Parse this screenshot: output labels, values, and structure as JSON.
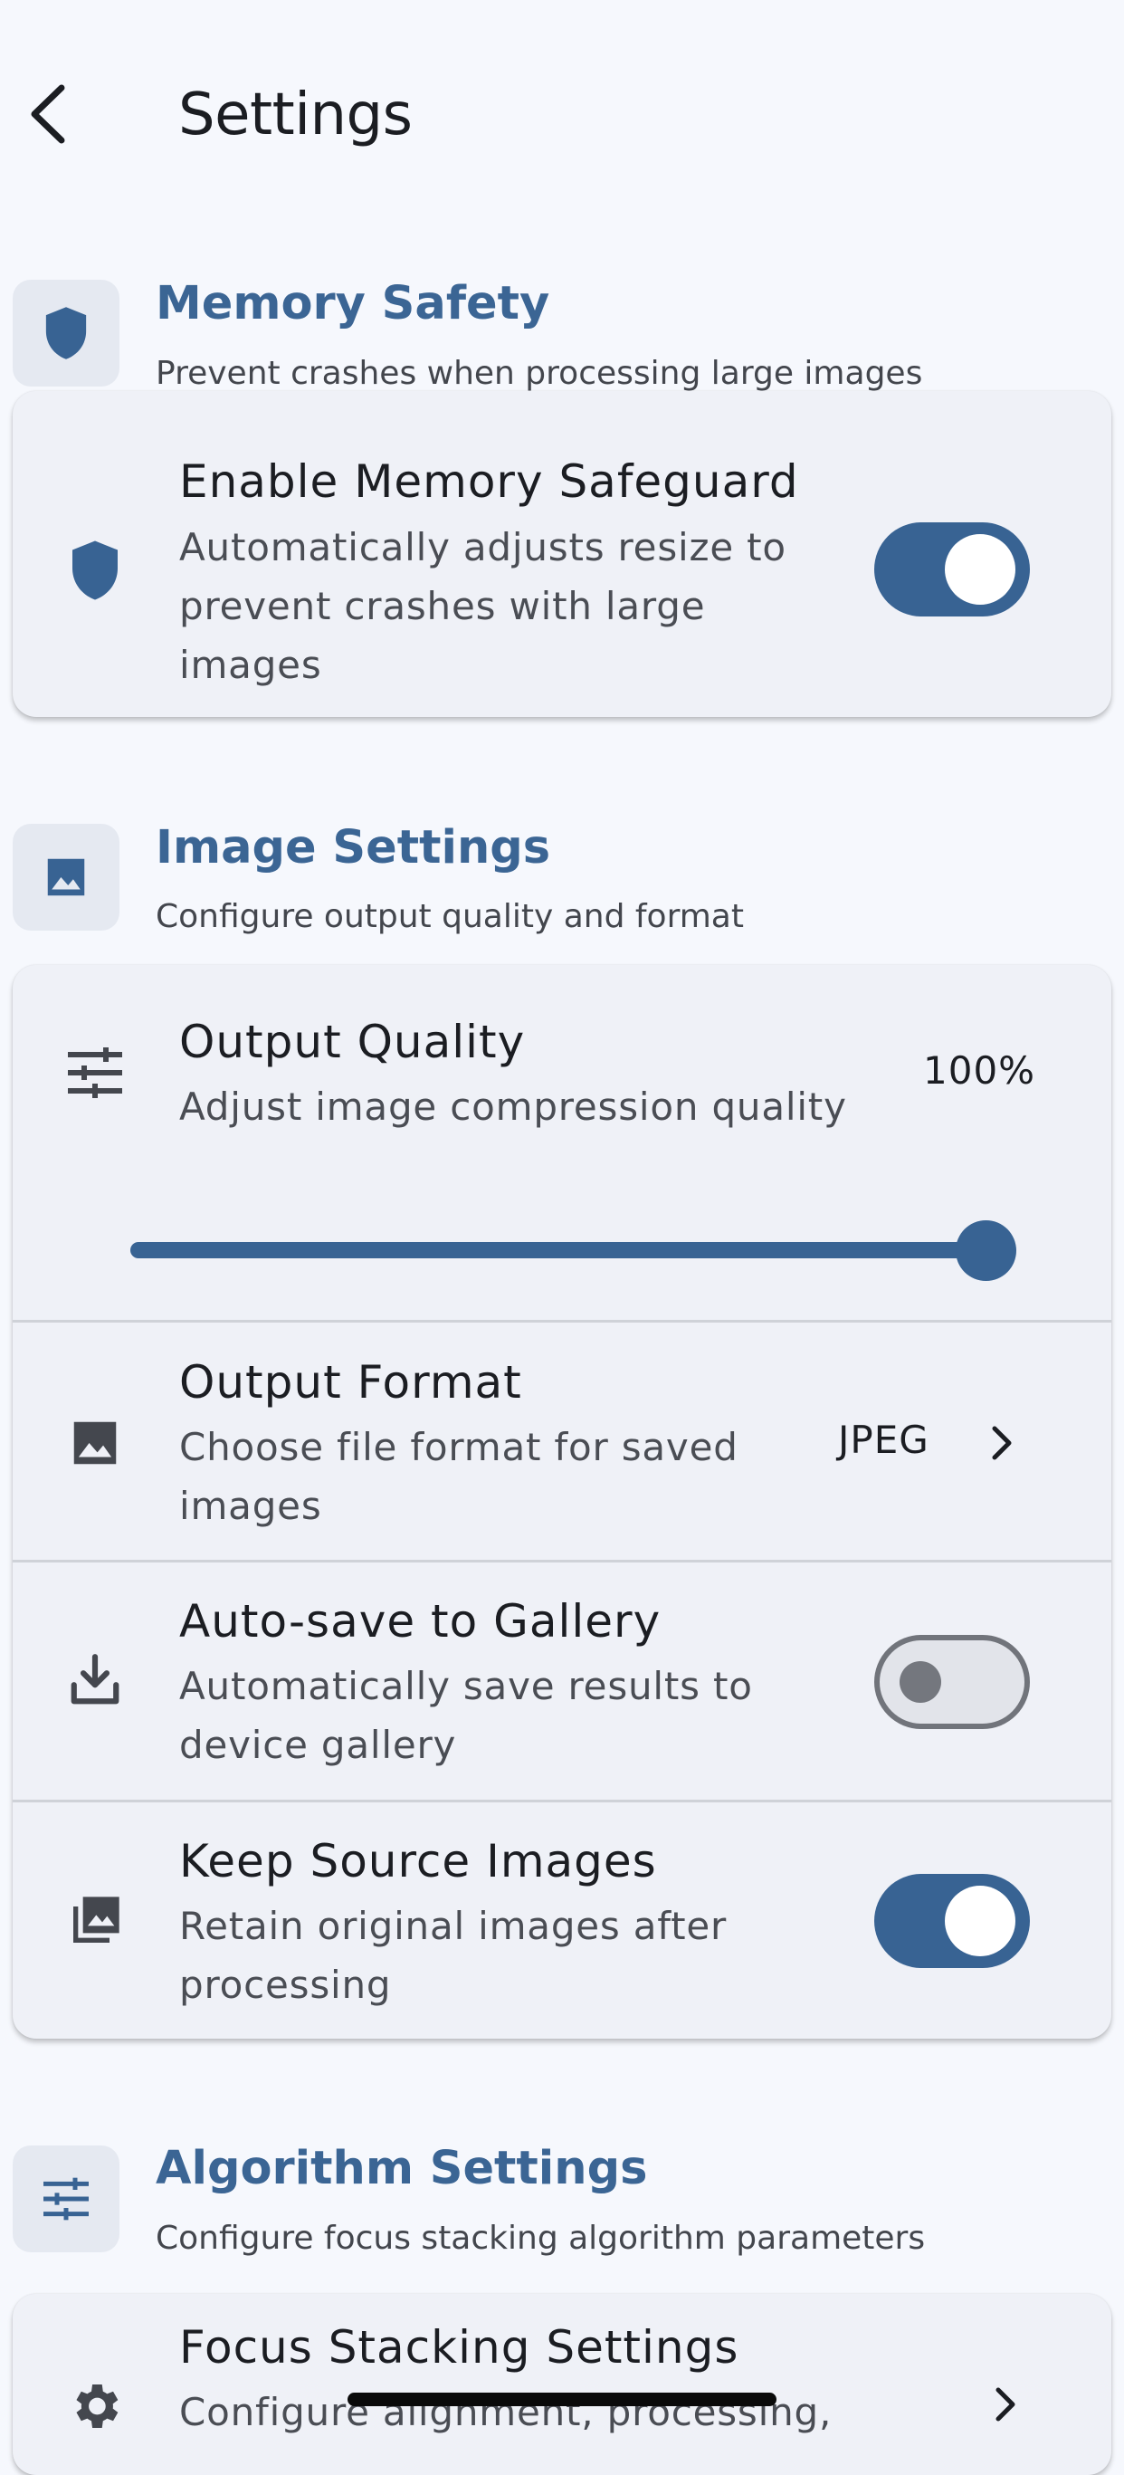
{
  "header": {
    "title": "Settings",
    "back_icon": "chevron-left-icon"
  },
  "sections": {
    "memory": {
      "title": "Memory Safety",
      "subtitle": "Prevent crashes when processing large images",
      "icon": "shield-icon",
      "rows": {
        "safeguard": {
          "title": "Enable Memory Safeguard",
          "description": "Automatically adjusts resize to prevent crashes with large images",
          "icon": "shield-icon",
          "enabled": true
        }
      }
    },
    "image": {
      "title": "Image Settings",
      "subtitle": "Configure output quality and format",
      "icon": "image-icon",
      "rows": {
        "quality": {
          "title": "Output Quality",
          "description": "Adjust image compression quality",
          "value": "100%",
          "slider_level": 1.0,
          "icon": "tune-icon"
        },
        "format": {
          "title": "Output Format",
          "description": "Choose file format for saved images",
          "value": "JPEG",
          "icon": "image-icon"
        },
        "autosave": {
          "title": "Auto-save to Gallery",
          "description": "Automatically save results to device gallery",
          "icon": "download-icon",
          "enabled": false
        },
        "keep_source": {
          "title": "Keep Source Images",
          "description": "Retain original images after processing",
          "icon": "photo-library-icon",
          "enabled": true
        }
      }
    },
    "algorithm": {
      "title": "Algorithm Settings",
      "subtitle": "Configure focus stacking algorithm parameters",
      "icon": "tune-icon",
      "rows": {
        "focus": {
          "title": "Focus Stacking Settings",
          "description": "Configure alignment, processing,",
          "icon": "gear-icon"
        }
      }
    }
  },
  "colors": {
    "accent": "#386393",
    "section_title": "#3b6594",
    "background": "#f6f8fd",
    "card": "#eff1f7"
  }
}
